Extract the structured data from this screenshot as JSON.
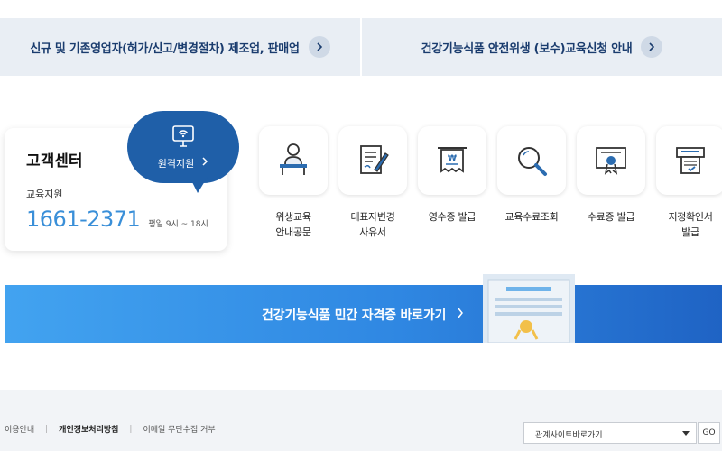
{
  "banners": [
    {
      "label": "신규 및 기존영업자(허가/신고/변경절차) 제조업, 판매업"
    },
    {
      "label": "건강기능식품 안전위생 (보수)교육신청 안내"
    }
  ],
  "customer_center": {
    "title": "고객센터",
    "subtitle": "교육지원",
    "phone": "1661-2371",
    "hours": "평일 9시 ~ 18시"
  },
  "remote_support": {
    "label": "원격지원"
  },
  "services": [
    {
      "label": "위생교육\n안내공문",
      "icon": "teacher-desk-icon"
    },
    {
      "label": "대표자변경\n사유서",
      "icon": "document-pen-icon"
    },
    {
      "label": "영수증 발급",
      "icon": "won-receipt-icon"
    },
    {
      "label": "교육수료조회",
      "icon": "magnifier-icon"
    },
    {
      "label": "수료증 발급",
      "icon": "certificate-icon"
    },
    {
      "label": "지정확인서\n발급",
      "icon": "printer-icon"
    }
  ],
  "cert_banner": {
    "label": "건강기능식품 민간 자격증 바로가기"
  },
  "footer": {
    "links": [
      "이용안내",
      "개인정보처리방침",
      "이메일 무단수집 거부"
    ],
    "related_sites_select": "관계사이트바로가기",
    "go_label": "GO"
  },
  "colors": {
    "brand_blue": "#1f5fa8",
    "phone_blue": "#3a8fd8",
    "banner_bg": "#e9eef4",
    "icon_accent": "#2b6cb0"
  }
}
